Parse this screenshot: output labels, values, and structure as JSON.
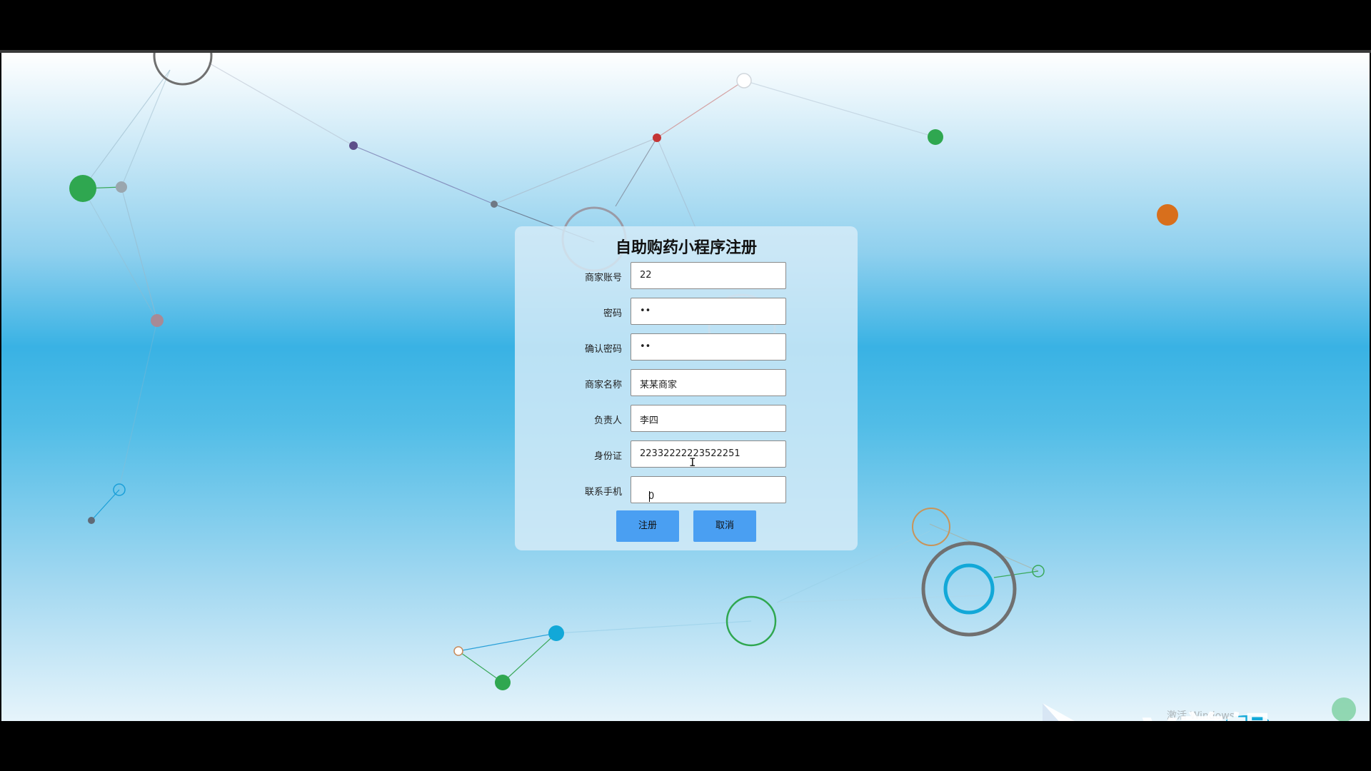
{
  "form": {
    "title": "自助购药小程序注册",
    "fields": [
      {
        "label": "商家账号",
        "value": "22"
      },
      {
        "label": "密码",
        "value": "••"
      },
      {
        "label": "确认密码",
        "value": "••"
      },
      {
        "label": "商家名称",
        "value": "某某商家"
      },
      {
        "label": "负责人",
        "value": "李四"
      },
      {
        "label": "身份证",
        "value": "22332222223522251"
      },
      {
        "label": "联系手机",
        "value": "0"
      }
    ],
    "register_label": "注册",
    "cancel_label": "取消"
  },
  "watermark": {
    "text": "eV剪辑",
    "activation_hint": "激活 Windows"
  },
  "colors": {
    "button": "#4a9ff2",
    "panel": "#d7ecf8",
    "accent_blue": "#39b2e4"
  }
}
